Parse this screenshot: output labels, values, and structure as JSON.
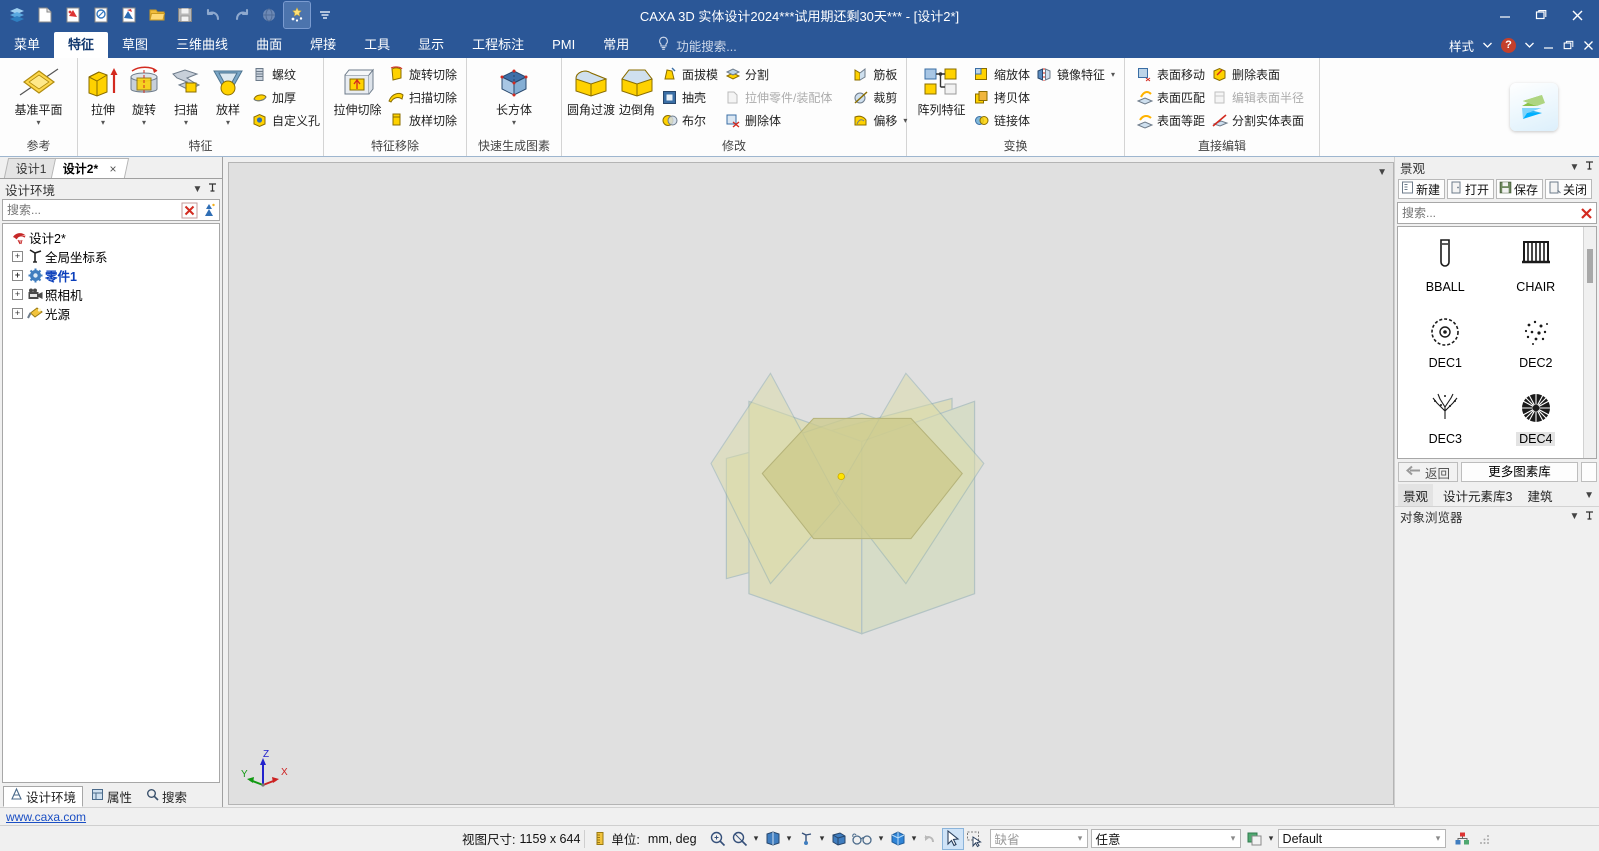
{
  "window": {
    "title": "CAXA 3D 实体设计2024***试用期还剩30天*** - [设计2*]",
    "accent": "#2b5797"
  },
  "quick_access": {
    "items": [
      {
        "name": "app-logo-icon",
        "label": "CAXA"
      },
      {
        "name": "new-document-icon",
        "label": "新建"
      },
      {
        "name": "new-drawing-icon",
        "label": "新建工程图"
      },
      {
        "name": "new-sheet-icon",
        "label": "新建图纸"
      },
      {
        "name": "new-assembly-icon",
        "label": "新建装配"
      },
      {
        "name": "open-folder-icon",
        "label": "打开"
      },
      {
        "name": "save-icon",
        "label": "保存"
      },
      {
        "name": "undo-icon",
        "label": "撤销"
      },
      {
        "name": "redo-icon",
        "label": "重做"
      },
      {
        "name": "render-icon",
        "label": "渲染"
      },
      {
        "name": "smart-icon",
        "label": "智能标注"
      },
      {
        "name": "customize-qat-icon",
        "label": "自定义快速启动工具栏"
      }
    ]
  },
  "window_buttons": [
    "最小化",
    "还原",
    "关闭"
  ],
  "menubar": {
    "tabs": [
      {
        "label": "菜单",
        "active": false
      },
      {
        "label": "特征",
        "active": true
      },
      {
        "label": "草图",
        "active": false
      },
      {
        "label": "三维曲线",
        "active": false
      },
      {
        "label": "曲面",
        "active": false
      },
      {
        "label": "焊接",
        "active": false
      },
      {
        "label": "工具",
        "active": false
      },
      {
        "label": "显示",
        "active": false
      },
      {
        "label": "工程标注",
        "active": false
      },
      {
        "label": "PMI",
        "active": false
      },
      {
        "label": "常用",
        "active": false
      }
    ],
    "function_search": "功能搜索...",
    "style_label": "样式",
    "help_mark": "?"
  },
  "ribbon": {
    "groups": [
      {
        "label": "参考",
        "big": [
          {
            "label": "基准平面",
            "icon": "datum-plane-icon",
            "caret": true
          }
        ],
        "small": []
      },
      {
        "label": "特征",
        "big": [
          {
            "label": "拉伸",
            "icon": "extrude-icon",
            "caret": true
          },
          {
            "label": "旋转",
            "icon": "revolve-icon",
            "caret": true
          },
          {
            "label": "扫描",
            "icon": "sweep-icon",
            "caret": true
          },
          {
            "label": "放样",
            "icon": "loft-icon",
            "caret": true
          }
        ],
        "small": [
          {
            "label": "螺纹",
            "icon": "thread-icon",
            "disabled": false
          },
          {
            "label": "加厚",
            "icon": "thicken-icon",
            "disabled": false
          },
          {
            "label": "自定义孔",
            "icon": "custom-hole-icon",
            "disabled": false
          }
        ]
      },
      {
        "label": "特征移除",
        "big": [
          {
            "label": "拉伸切除",
            "icon": "extrude-cut-icon",
            "caret": false
          }
        ],
        "small": [
          {
            "label": "旋转切除",
            "icon": "revolve-cut-icon",
            "disabled": false
          },
          {
            "label": "扫描切除",
            "icon": "sweep-cut-icon",
            "disabled": false
          },
          {
            "label": "放样切除",
            "icon": "loft-cut-icon",
            "disabled": false
          }
        ]
      },
      {
        "label": "快速生成图素",
        "big": [
          {
            "label": "长方体",
            "icon": "box-icon",
            "caret": true
          }
        ],
        "small": []
      },
      {
        "label": "修改",
        "big": [
          {
            "label": "圆角过渡",
            "icon": "fillet-icon",
            "caret": false
          },
          {
            "label": "边倒角",
            "icon": "chamfer-icon",
            "caret": false
          }
        ],
        "small": [
          {
            "label": "面拔模",
            "icon": "draft-face-icon",
            "disabled": false
          },
          {
            "label": "抽壳",
            "icon": "shell-icon",
            "disabled": false
          },
          {
            "label": "布尔",
            "icon": "boolean-icon",
            "disabled": false
          }
        ],
        "small2": [
          {
            "label": "分割",
            "icon": "split-icon",
            "disabled": false
          },
          {
            "label": "拉伸零件/装配体",
            "icon": "extrude-part-icon",
            "disabled": true
          },
          {
            "label": "删除体",
            "icon": "delete-body-icon",
            "disabled": false
          }
        ],
        "small3": [
          {
            "label": "筋板",
            "icon": "rib-icon",
            "disabled": false
          },
          {
            "label": "裁剪",
            "icon": "trim-icon",
            "disabled": false
          },
          {
            "label": "偏移",
            "icon": "offset-icon",
            "disabled": false,
            "caret": true
          }
        ]
      },
      {
        "label": "变换",
        "big": [
          {
            "label": "阵列特征",
            "icon": "pattern-feature-icon",
            "caret": false
          }
        ],
        "small": [
          {
            "label": "缩放体",
            "icon": "scale-body-icon",
            "disabled": false
          },
          {
            "label": "拷贝体",
            "icon": "copy-body-icon",
            "disabled": false
          },
          {
            "label": "链接体",
            "icon": "link-body-icon",
            "disabled": false
          }
        ],
        "small2": [
          {
            "label": "镜像特征",
            "icon": "mirror-feature-icon",
            "disabled": false,
            "caret": true
          }
        ]
      },
      {
        "label": "直接编辑",
        "big": [],
        "small": [
          {
            "label": "表面移动",
            "icon": "move-face-icon",
            "disabled": false
          },
          {
            "label": "表面匹配",
            "icon": "match-face-icon",
            "disabled": false
          },
          {
            "label": "表面等距",
            "icon": "offset-face-icon",
            "disabled": false
          }
        ],
        "small2": [
          {
            "label": "删除表面",
            "icon": "delete-face-icon",
            "disabled": false
          },
          {
            "label": "编辑表面半径",
            "icon": "edit-face-radius-icon",
            "disabled": true
          },
          {
            "label": "分割实体表面",
            "icon": "split-solid-face-icon",
            "disabled": false
          }
        ]
      }
    ]
  },
  "left_panel": {
    "doc_tabs": [
      {
        "label": "设计1",
        "active": false,
        "closable": false
      },
      {
        "label": "设计2*",
        "active": true,
        "closable": true,
        "close": "×"
      }
    ],
    "panel_title": "设计环境",
    "search_placeholder": "搜索...",
    "tree": [
      {
        "label": "设计2*",
        "icon": "scene-root-icon",
        "level": 0,
        "expander": "",
        "blue": false
      },
      {
        "label": "全局坐标系",
        "icon": "global-coordinate-icon",
        "level": 1,
        "expander": "+",
        "blue": false
      },
      {
        "label": "零件1",
        "icon": "part-icon",
        "level": 1,
        "expander": "+",
        "blue": true
      },
      {
        "label": "照相机",
        "icon": "camera-icon",
        "level": 1,
        "expander": "+",
        "blue": false
      },
      {
        "label": "光源",
        "icon": "light-icon",
        "level": 1,
        "expander": "+",
        "blue": false
      }
    ],
    "bottom_tabs": [
      {
        "label": "设计环境",
        "icon": "design-env-icon",
        "active": true
      },
      {
        "label": "属性",
        "icon": "properties-icon",
        "active": false
      },
      {
        "label": "搜索",
        "icon": "search-icon",
        "active": false
      }
    ]
  },
  "right_panel": {
    "panel_title": "景观",
    "buttons": [
      {
        "label": "新建",
        "icon": "new-catalog-icon"
      },
      {
        "label": "打开",
        "icon": "open-catalog-icon"
      },
      {
        "label": "保存",
        "icon": "save-catalog-icon"
      },
      {
        "label": "关闭",
        "icon": "close-catalog-icon"
      }
    ],
    "search_placeholder": "搜索...",
    "catalog_items": [
      {
        "label": "BBALL",
        "icon": "bball-icon",
        "selected": false
      },
      {
        "label": "CHAIR",
        "icon": "chair-icon",
        "selected": false
      },
      {
        "label": "DEC1",
        "icon": "dec1-icon",
        "selected": false
      },
      {
        "label": "DEC2",
        "icon": "dec2-icon",
        "selected": false
      },
      {
        "label": "DEC3",
        "icon": "dec3-icon",
        "selected": false
      },
      {
        "label": "DEC4",
        "icon": "dec4-icon",
        "selected": true
      }
    ],
    "nav": {
      "back": "返回",
      "more": "更多图素库"
    },
    "catalog_tabs": [
      {
        "label": "景观",
        "active": true
      },
      {
        "label": "设计元素库3",
        "active": false
      },
      {
        "label": "建筑",
        "active": false
      }
    ],
    "object_browser_title": "对象浏览器"
  },
  "viewport": {
    "triad": {
      "x": "X",
      "y": "Y",
      "z": "Z"
    },
    "background": "#e0e0e0",
    "plane_fill": "#d9d9a0",
    "plane_stroke": "#8fadad",
    "center_point_color": "#ffe400"
  },
  "footer": {
    "link": "www.caxa.com"
  },
  "statusbar": {
    "view_size_label": "视图尺寸:",
    "view_size_value": "1159 x  644",
    "unit_label": "单位:",
    "unit_value": "mm, deg",
    "icons": [
      {
        "name": "zoom-window-icon",
        "caret": false
      },
      {
        "name": "zoom-dynamic-icon",
        "caret": true
      },
      {
        "name": "view-orientation-icon",
        "caret": true
      },
      {
        "name": "view-rotate-icon",
        "caret": false
      },
      {
        "name": "glasses-stereo-icon",
        "caret": true
      },
      {
        "name": "render-mode-icon",
        "caret": true
      },
      {
        "name": "shadow-icon",
        "caret": false
      },
      {
        "name": "select-arrow-icon",
        "caret": false,
        "selected": true
      },
      {
        "name": "select-box-icon",
        "caret": false
      }
    ],
    "combo_default": "缺省",
    "combo_any": "任意",
    "combo_style": "Default",
    "resize-grip": "调整大小"
  }
}
